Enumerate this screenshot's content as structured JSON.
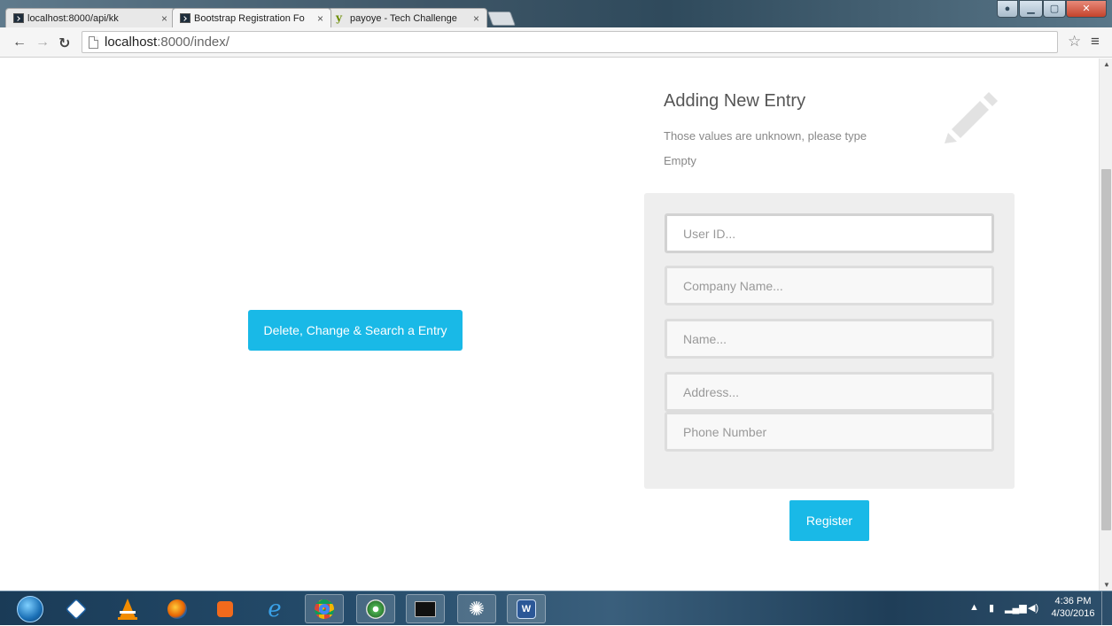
{
  "browser": {
    "tabs": [
      {
        "label": "localhost:8000/api/kk",
        "active": false
      },
      {
        "label": "Bootstrap Registration Fo",
        "active": true
      },
      {
        "label": "payoye - Tech Challenge",
        "active": false
      }
    ],
    "tab_close_glyph": "×",
    "url_host": "localhost",
    "url_rest": ":8000/index/"
  },
  "page": {
    "delete_button_label": "Delete, Change & Search a Entry",
    "form": {
      "title": "Adding New Entry",
      "subtitle": "Those values are unknown, please type",
      "note": "Empty",
      "fields": {
        "user_id_placeholder": "User ID...",
        "company_placeholder": "Company Name...",
        "name_placeholder": "Name...",
        "address_placeholder": "Address...",
        "phone_placeholder": "Phone Number"
      },
      "register_label": "Register"
    },
    "accent_color": "#19b9e7"
  },
  "taskbar": {
    "icons": [
      "windows-start-icon",
      "virtualbox-icon",
      "vlc-icon",
      "firefox-icon",
      "media-player-icon",
      "internet-explorer-icon",
      "chrome-icon",
      "app-icon",
      "terminal-icon",
      "network-tool-icon",
      "word-icon"
    ],
    "time": "4:36 PM",
    "date": "4/30/2016"
  }
}
